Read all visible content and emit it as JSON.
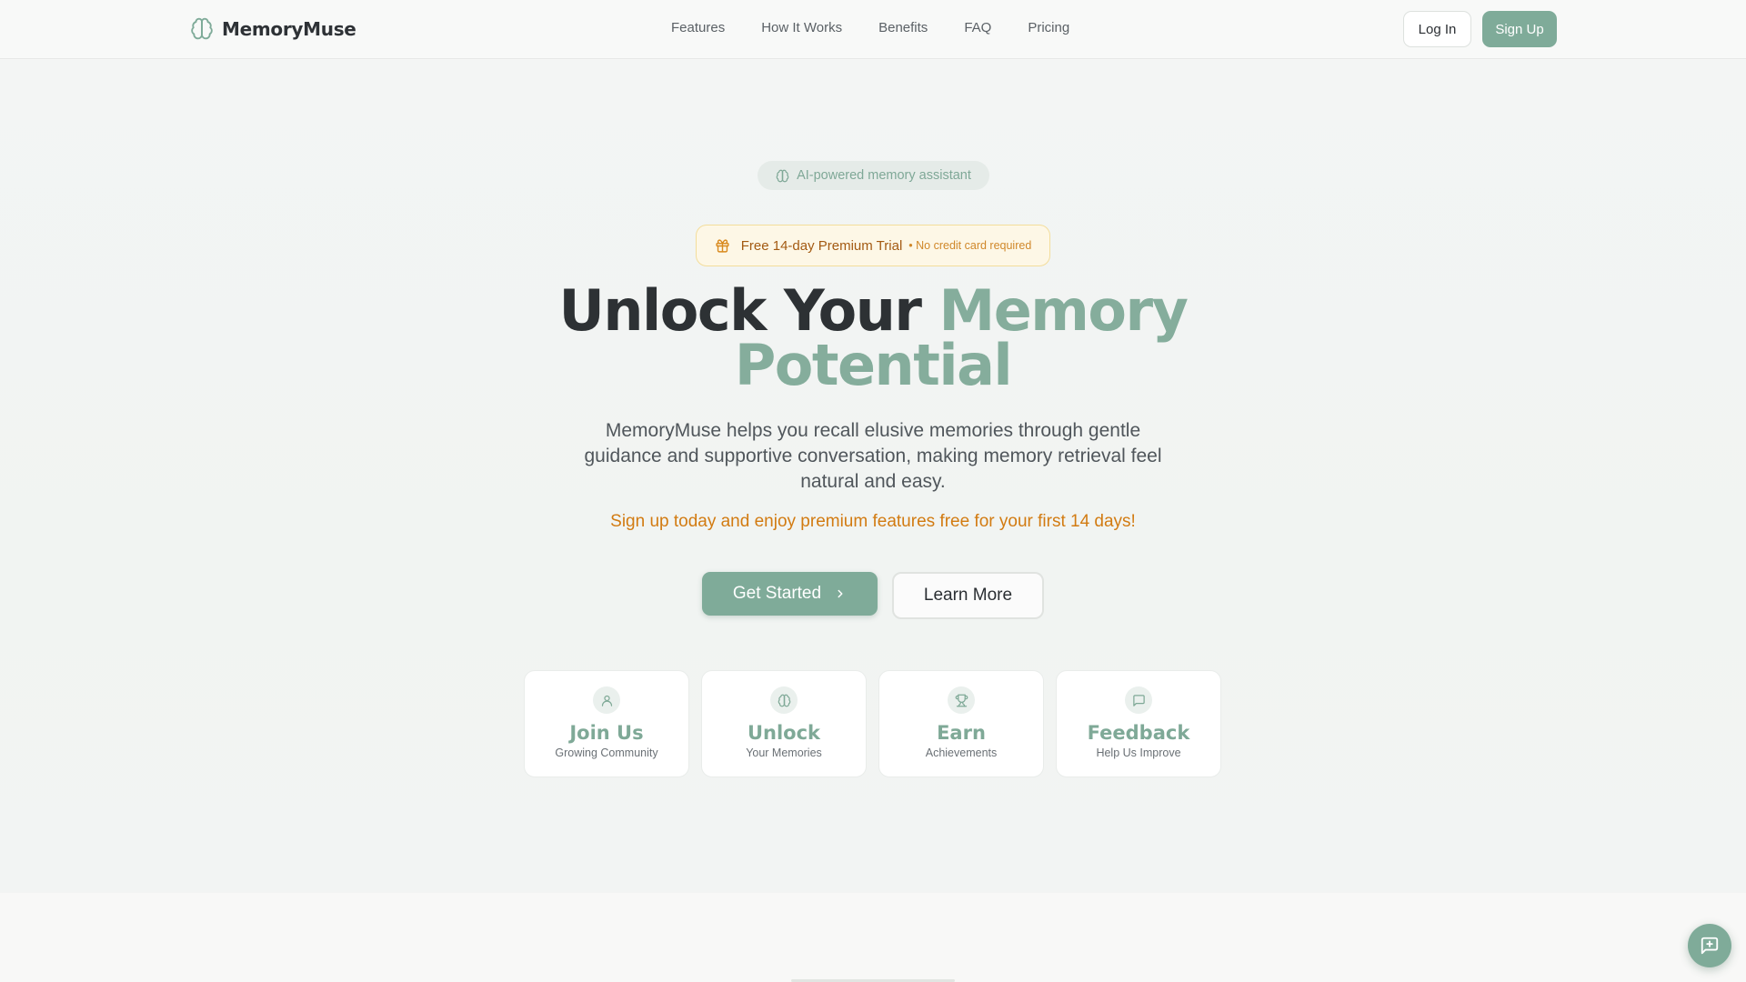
{
  "header": {
    "brand": "MemoryMuse",
    "nav": [
      "Features",
      "How It Works",
      "Benefits",
      "FAQ",
      "Pricing"
    ],
    "login_label": "Log In",
    "signup_label": "Sign Up"
  },
  "hero": {
    "badge": "AI-powered memory assistant",
    "trial_main": "Free 14-day Premium Trial",
    "trial_sub": "• No credit card required",
    "title_part1": "Unlock Your ",
    "title_accent1": "Memory",
    "title_accent2": "Potential",
    "subtitle": "MemoryMuse helps you recall elusive memories through gentle guidance and supportive conversation, making memory retrieval feel natural and easy.",
    "promo": "Sign up today and enjoy premium features free for your first 14 days!",
    "cta_primary": "Get Started",
    "cta_secondary": "Learn More"
  },
  "cards": [
    {
      "title": "Join Us",
      "subtitle": "Growing Community",
      "icon": "user-icon"
    },
    {
      "title": "Unlock",
      "subtitle": "Your Memories",
      "icon": "brain-icon"
    },
    {
      "title": "Earn",
      "subtitle": "Achievements",
      "icon": "trophy-icon"
    },
    {
      "title": "Feedback",
      "subtitle": "Help Us Improve",
      "icon": "message-icon"
    }
  ],
  "colors": {
    "accent": "#7fab99",
    "promo": "#d27b12",
    "trial_bg": "#fdf7e6"
  }
}
